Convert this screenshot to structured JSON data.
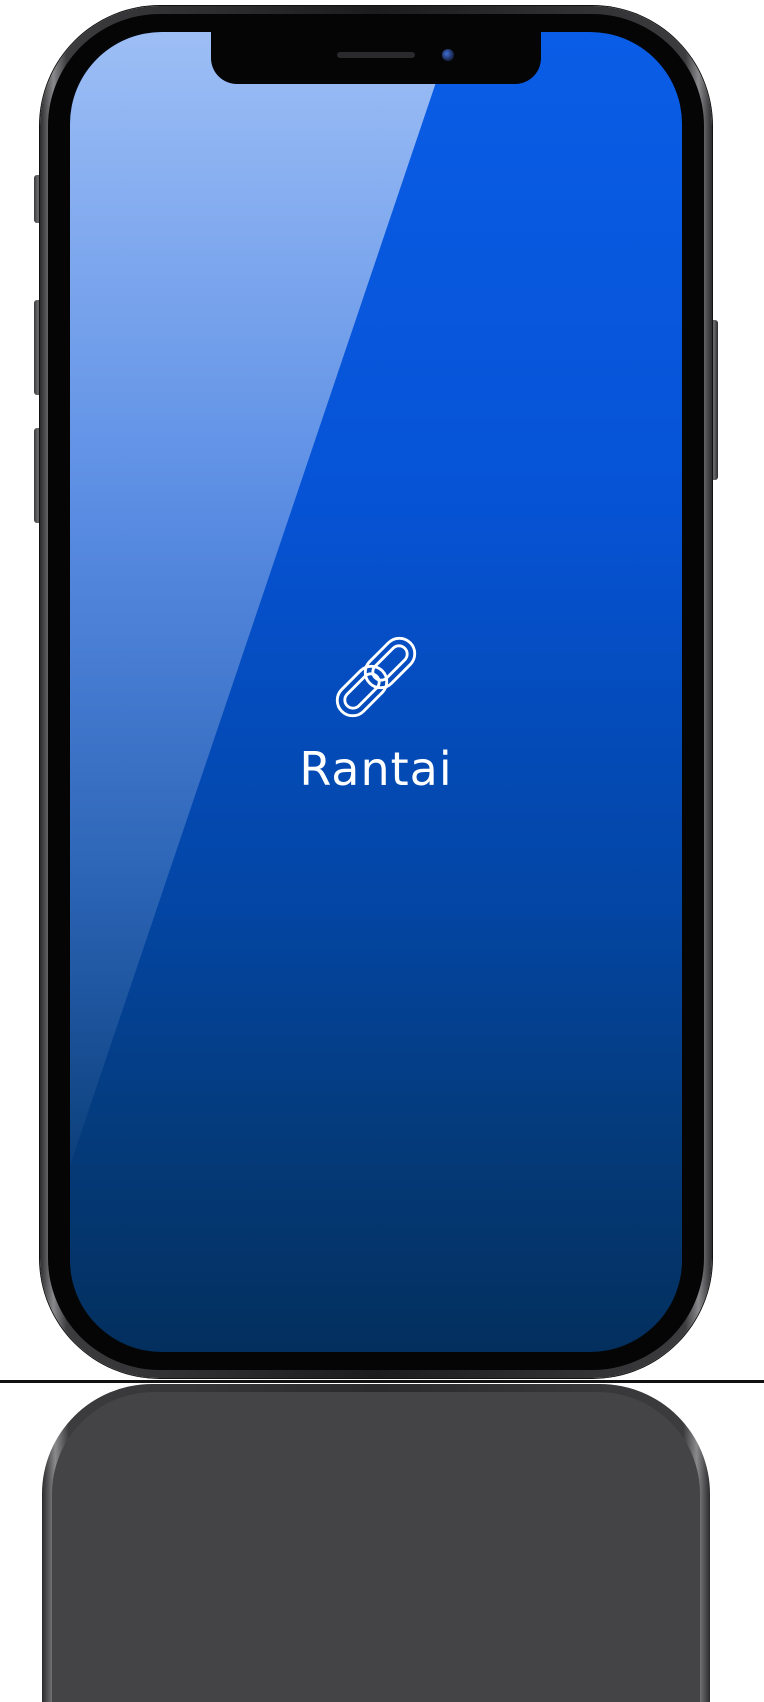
{
  "app": {
    "name": "Rantai",
    "icon": "chain-link-icon"
  },
  "colors": {
    "screen_top": "#0a5de6",
    "screen_bottom": "#032f5e",
    "text": "#ffffff",
    "frame": "#1c1c1e"
  }
}
